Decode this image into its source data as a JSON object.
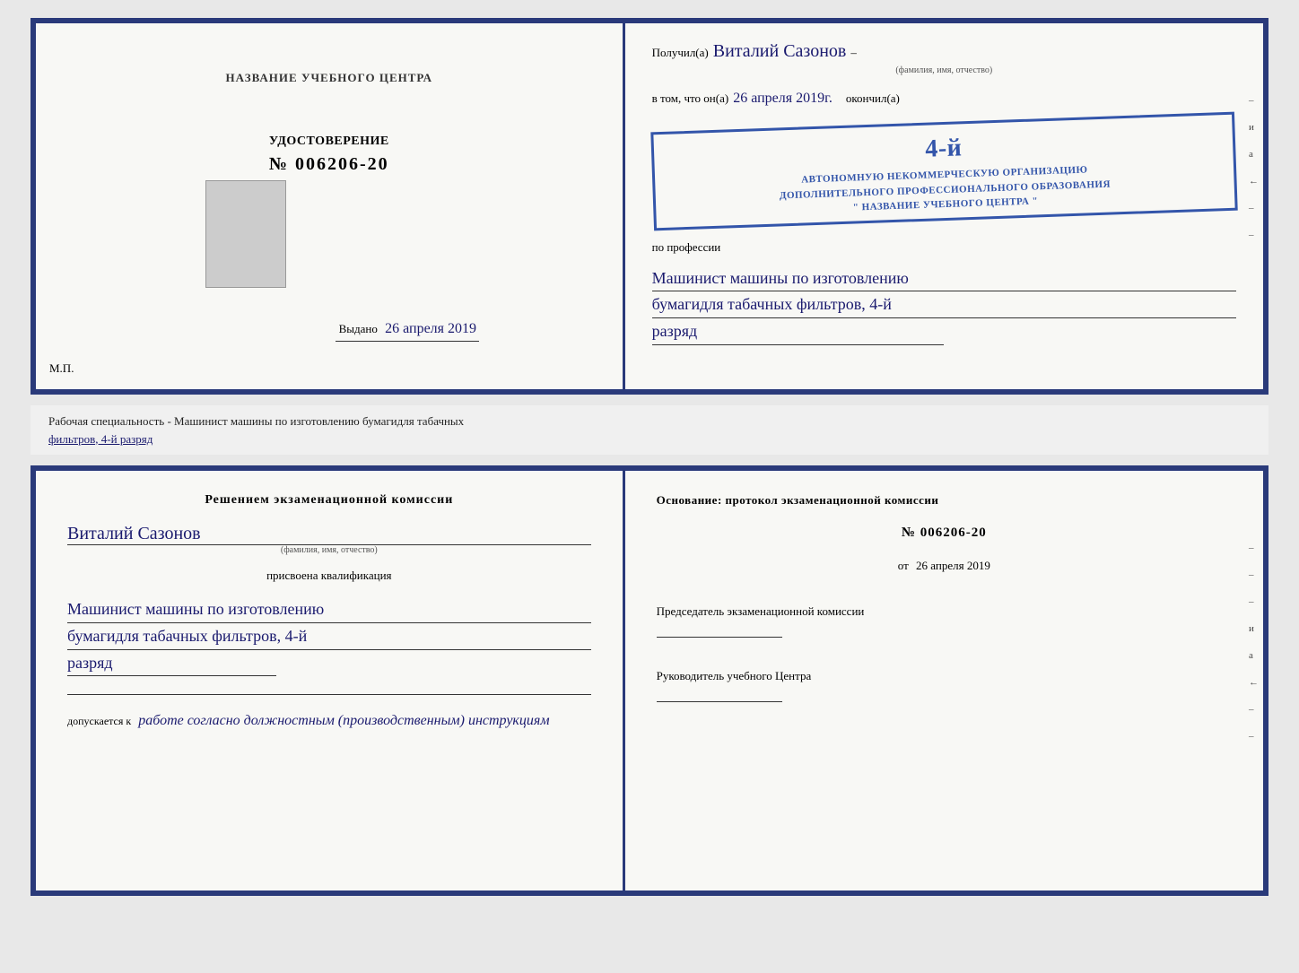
{
  "doc1": {
    "left": {
      "center_label": "НАЗВАНИЕ УЧЕБНОГО ЦЕНТРА",
      "certificate_title": "УДОСТОВЕРЕНИЕ",
      "cert_number": "№ 006206-20",
      "issued_label": "Выдано",
      "issued_date": "26 апреля 2019",
      "mp_label": "М.П."
    },
    "right": {
      "received_prefix": "Получил(а)",
      "recipient_name": "Виталий Сазонов",
      "recipient_sublabel": "(фамилия, имя, отчество)",
      "in_fact_prefix": "в том, что он(а)",
      "in_fact_date": "26 апреля 2019г.",
      "finished_label": "окончил(а)",
      "stamp_line1": "4-й",
      "stamp_line2": "АВТОНОМНУЮ НЕКОММЕРЧЕСКУЮ ОРГАНИЗАЦИЮ",
      "stamp_line3": "ДОПОЛНИТЕЛЬНОГО ПРОФЕССИОНАЛЬНОГО ОБРАЗОВАНИЯ",
      "stamp_line4": "\" НАЗВАНИЕ УЧЕБНОГО ЦЕНТРА \"",
      "profession_prefix": "по профессии",
      "profession_line1": "Машинист машины по изготовлению",
      "profession_line2": "бумагидля табачных фильтров, 4-й",
      "profession_line3": "разряд",
      "decorations": [
        "–",
        "и",
        "а",
        "←",
        "–",
        "–",
        "–",
        "–"
      ]
    }
  },
  "middle": {
    "text": "Рабочая специальность - Машинист машины по изготовлению бумагидля табачных",
    "text2": "фильтров, 4-й разряд"
  },
  "doc2": {
    "left": {
      "decision_text": "Решением  экзаменационной  комиссии",
      "person_name": "Виталий Сазонов",
      "person_sublabel": "(фамилия, имя, отчество)",
      "assigned_text": "присвоена квалификация",
      "qualification_line1": "Машинист машины по изготовлению",
      "qualification_line2": "бумагидля табачных фильтров, 4-й",
      "qualification_line3": "разряд",
      "allowed_prefix": "допускается к",
      "allowed_text": "работе согласно должностным (производственным) инструкциям"
    },
    "right": {
      "basis_text": "Основание: протокол экзаменационной  комиссии",
      "number": "№  006206-20",
      "date_prefix": "от",
      "date": "26 апреля 2019",
      "chairman_label": "Председатель экзаменационной комиссии",
      "director_label": "Руководитель учебного Центра",
      "decorations": [
        "–",
        "–",
        "–",
        "и",
        "а",
        "←",
        "–",
        "–",
        "–"
      ]
    }
  }
}
